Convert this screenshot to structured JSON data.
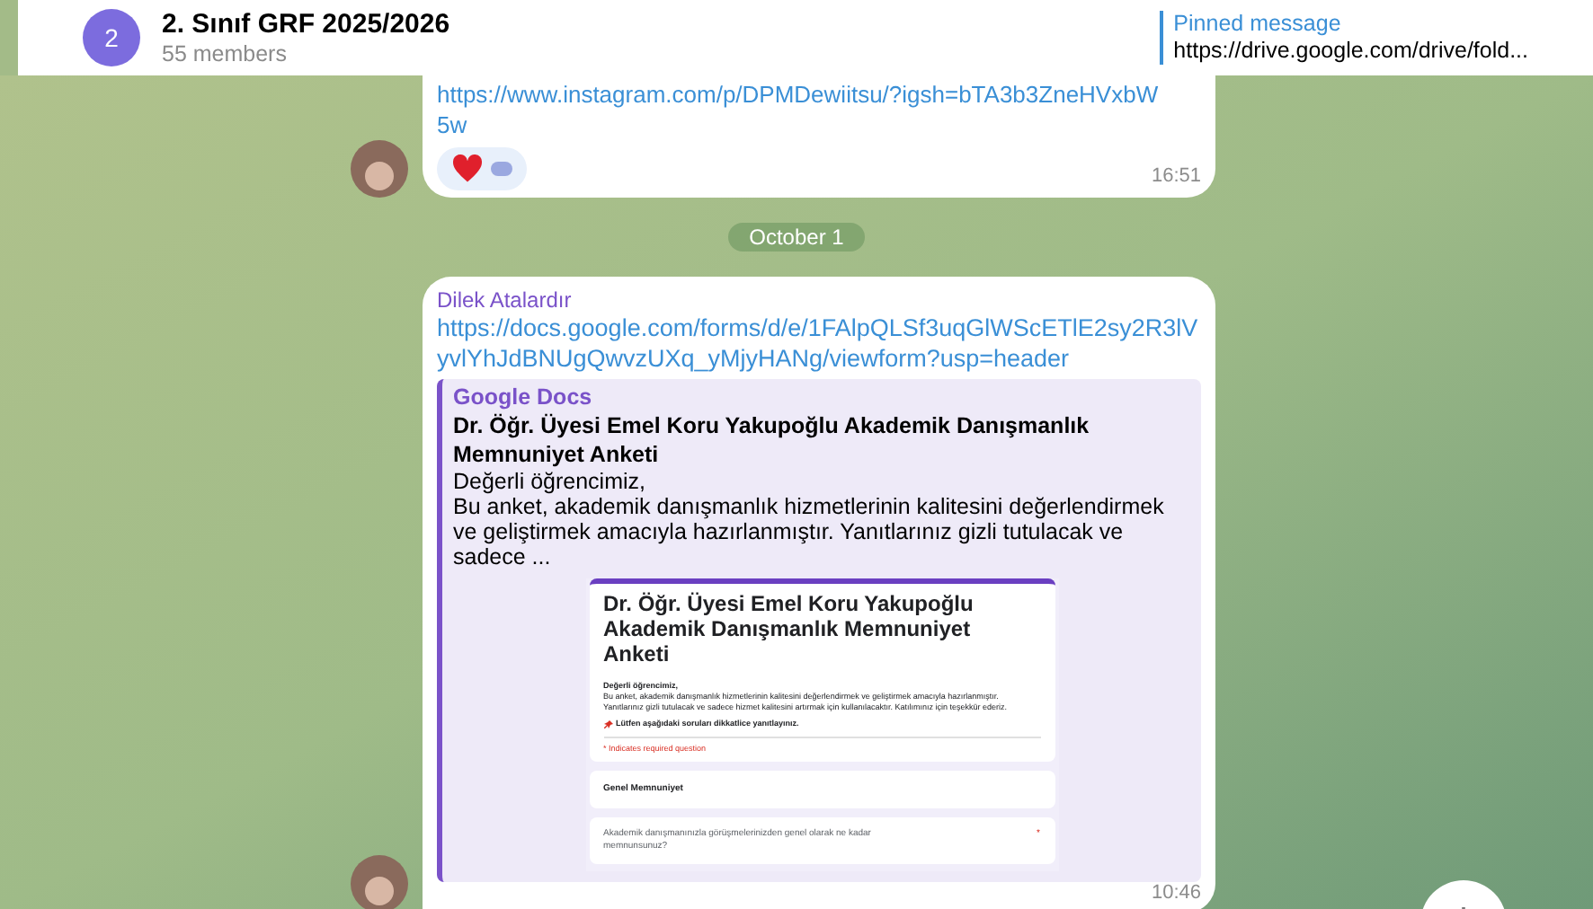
{
  "header": {
    "avatar_text": "2",
    "title": "2. Sınıf GRF 2025/2026",
    "subtitle": "55 members"
  },
  "pinned": {
    "label": "Pinned message",
    "text": "https://drive.google.com/drive/fold..."
  },
  "messages": [
    {
      "kind": "link",
      "link": "https://www.instagram.com/p/DPMDewiitsu/?igsh=bTA3b3ZneHVxbW5w",
      "time": "16:51"
    },
    {
      "kind": "date",
      "text": "October 1"
    },
    {
      "kind": "preview",
      "sender": "Dilek Atalardır",
      "link": "https://docs.google.com/forms/d/e/1FAlpQLSf3uqGlWScETlE2sy2R3lVyvlYhJdBNUgQwvzUXq_yMjyHANg/viewform?usp=header",
      "site": "Google Docs",
      "title": "Dr. Öğr. Üyesi Emel Koru Yakupoğlu Akademik Danışmanlık Memnuniyet Anketi",
      "description": "Değerli öğrencimiz,\nBu anket, akademik danışmanlık hizmetlerinin kalitesini değerlendirmek ve geliştirmek amacıyla hazırlanmıştır. Yanıtlarınız gizli tutulacak ve sadece ...",
      "form": {
        "title": "Dr. Öğr. Üyesi Emel Koru Yakupoğlu Akademik Danışmanlık Memnuniyet Anketi",
        "greeting": "Değerli öğrencimiz,",
        "body": "Bu anket, akademik danışmanlık hizmetlerinin kalitesini değerlendirmek ve geliştirmek amacıyla hazırlanmıştır. Yanıtlarınız gizli tutulacak ve sadece hizmet kalitesini artırmak için kullanılacaktır. Katılımınız için teşekkür ederiz.",
        "note": "Lütfen aşağıdaki soruları dikkatlice yanıtlayınız.",
        "required_note": "* Indicates required question",
        "section": "Genel Memnuniyet",
        "question": "Akademik danışmanınızla görüşmelerinizden genel olarak ne kadar memnunsunuz?",
        "question_mark": "*"
      },
      "time": "10:46"
    }
  ]
}
